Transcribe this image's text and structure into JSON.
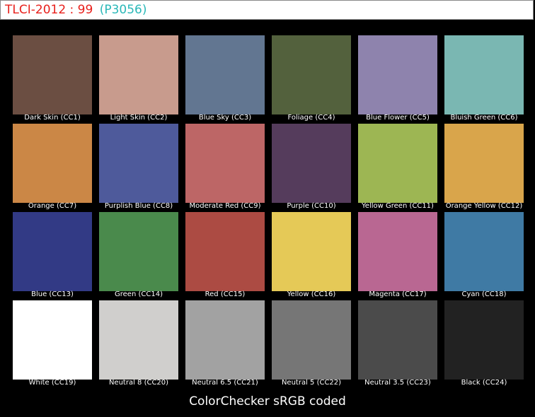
{
  "header": {
    "title": "TLCI-2012 : 99",
    "code": "(P3056)"
  },
  "caption": "ColorChecker sRGB coded",
  "patches": [
    {
      "label": "Dark Skin (CC1)",
      "color": "#6b4e42"
    },
    {
      "label": "Light Skin (CC2)",
      "color": "#c89b8d"
    },
    {
      "label": "Blue Sky (CC3)",
      "color": "#627691"
    },
    {
      "label": "Foliage (CC4)",
      "color": "#53613d"
    },
    {
      "label": "Blue Flower (CC5)",
      "color": "#8e83ad"
    },
    {
      "label": "Bluish Green (CC6)",
      "color": "#7ab7b2"
    },
    {
      "label": "Orange (CC7)",
      "color": "#cb8746"
    },
    {
      "label": "Purplish Blue (CC8)",
      "color": "#4e5a9b"
    },
    {
      "label": "Moderate Red (CC9)",
      "color": "#bd6666"
    },
    {
      "label": "Purple (CC10)",
      "color": "#553c5c"
    },
    {
      "label": "Yellow Green (CC11)",
      "color": "#9db653"
    },
    {
      "label": "Orange Yellow (CC12)",
      "color": "#d9a54b"
    },
    {
      "label": "Blue (CC13)",
      "color": "#323a85"
    },
    {
      "label": "Green (CC14)",
      "color": "#4a8a4c"
    },
    {
      "label": "Red (CC15)",
      "color": "#ac4b43"
    },
    {
      "label": "Yellow (CC16)",
      "color": "#e5c957"
    },
    {
      "label": "Magenta (CC17)",
      "color": "#b96792"
    },
    {
      "label": "Cyan (CC18)",
      "color": "#3f7aa4"
    },
    {
      "label": "White (CC19)",
      "color": "#ffffff"
    },
    {
      "label": "Neutral 8 (CC20)",
      "color": "#d0cfcd"
    },
    {
      "label": "Neutral 6.5 (CC21)",
      "color": "#a2a2a2"
    },
    {
      "label": "Neutral 5 (CC22)",
      "color": "#767676"
    },
    {
      "label": "Neutral 3.5 (CC23)",
      "color": "#4b4b4b"
    },
    {
      "label": "Black (CC24)",
      "color": "#222222"
    }
  ]
}
